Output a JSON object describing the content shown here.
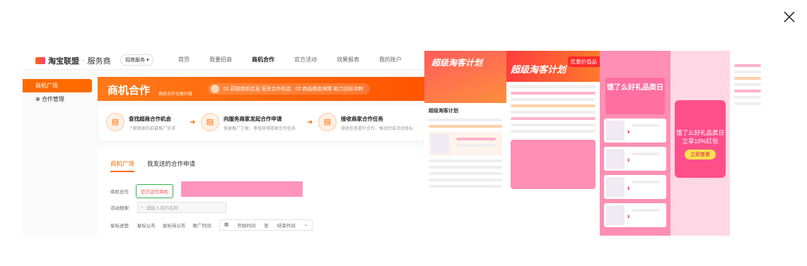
{
  "viewer": {
    "close_label": "×"
  },
  "left_screenshot": {
    "brand": "淘宝联盟",
    "brand_sub": "服务商",
    "invite_dropdown": "招商服务",
    "nav": [
      "首页",
      "我要招商",
      "商机合作",
      "官方活动",
      "效果报表",
      "我的账户"
    ],
    "nav_active_index": 2,
    "sidebar": [
      {
        "label": "商机广场",
        "active": true
      },
      {
        "label": "合作管理",
        "active": false
      }
    ],
    "banner_title": "商机合作",
    "banner_sub": "商机合作全面升级",
    "banner_step1": "01 获取商机信息 拓充合作机会",
    "banner_step2": "02 商品佣金保障 助力目标冲刺",
    "steps": [
      {
        "title": "查找超商合作机会",
        "desc": "了解商家的招募推广诉求"
      },
      {
        "title": "向服务商家发起合作申请",
        "desc": "快速推广方案，争取获得商家合作任务"
      },
      {
        "title": "接收商家合作任务",
        "desc": "接收任务提升合作，推动完成活动目标"
      }
    ],
    "tabs": [
      "商机广场",
      "我发送的合作申请"
    ],
    "filter_label_1": "商机合作",
    "filter_chip": "官方运作商机",
    "filter_label_2": "活动搜索:",
    "search_placeholder": "请输入商的名称",
    "filter_label_3": "星标进度:",
    "filter_opt_1": "星标公布",
    "filter_opt_2": "星标待公布",
    "filter_label_4": "推广时间:",
    "date_start": "开始时间",
    "date_sep": "至",
    "date_end": "结束时间"
  },
  "right_collage": {
    "tile1_title": "超级淘客计划",
    "tile1_card_title": "超级淘客计划",
    "tile2_title": "超级淘客计划",
    "tile2_badge": "优惠价值品",
    "tile3_title": "饿了么好礼品类日",
    "tile4_promo": "饿了么好礼品类日",
    "tile4_sub": "立享10%红包",
    "tile4_btn": "立即查看",
    "colors": {
      "accent_orange": "#ff6a00",
      "pink": "#ff6fa0",
      "red": "#ff3d3d"
    }
  }
}
